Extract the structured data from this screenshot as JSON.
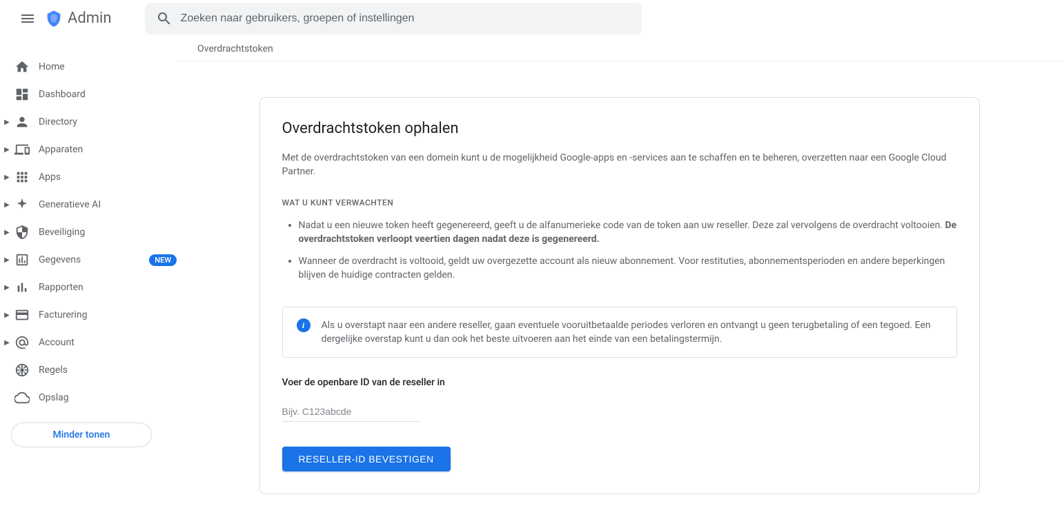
{
  "header": {
    "appName": "Admin",
    "searchPlaceholder": "Zoeken naar gebruikers, groepen of instellingen"
  },
  "sidebar": {
    "items": [
      {
        "label": "Home",
        "expandable": false,
        "icon": "home"
      },
      {
        "label": "Dashboard",
        "expandable": false,
        "icon": "dashboard"
      },
      {
        "label": "Directory",
        "expandable": true,
        "icon": "person"
      },
      {
        "label": "Apparaten",
        "expandable": true,
        "icon": "devices"
      },
      {
        "label": "Apps",
        "expandable": true,
        "icon": "apps"
      },
      {
        "label": "Generatieve AI",
        "expandable": true,
        "icon": "sparkle"
      },
      {
        "label": "Beveiliging",
        "expandable": true,
        "icon": "shield"
      },
      {
        "label": "Gegevens",
        "expandable": true,
        "icon": "data",
        "badge": "NEW"
      },
      {
        "label": "Rapporten",
        "expandable": true,
        "icon": "bars"
      },
      {
        "label": "Facturering",
        "expandable": true,
        "icon": "card"
      },
      {
        "label": "Account",
        "expandable": true,
        "icon": "at"
      },
      {
        "label": "Regels",
        "expandable": false,
        "icon": "wheel"
      },
      {
        "label": "Opslag",
        "expandable": false,
        "icon": "cloud"
      }
    ],
    "lessButton": "Minder tonen"
  },
  "breadcrumb": "Overdrachtstoken",
  "card": {
    "title": "Overdrachtstoken ophalen",
    "description": "Met de overdrachtstoken van een domein kunt u de mogelijkheid Google-apps en -services aan te schaffen en te beheren, overzetten naar een Google Cloud Partner.",
    "expectLabel": "WAT U KUNT VERWACHTEN",
    "bullet1a": "Nadat u een nieuwe token heeft gegenereerd, geeft u de alfanumerieke code van de token aan uw reseller. Deze zal vervolgens de overdracht voltooien. ",
    "bullet1b": "De overdrachtstoken verloopt veertien dagen nadat deze is gegenereerd.",
    "bullet2": "Wanneer de overdracht is voltooid, geldt uw overgezette account als nieuw abonnement. Voor restituties, abonnementsperioden en andere beperkingen blijven de huidige contracten gelden.",
    "infoText": "Als u overstapt naar een andere reseller, gaan eventuele vooruitbetaalde periodes verloren en ontvangt u geen terugbetaling of een tegoed. Een dergelijke overstap kunt u dan ook het beste uitvoeren aan het einde van een betalingstermijn.",
    "fieldLabel": "Voer de openbare ID van de reseller in",
    "fieldPlaceholder": "Bijv. C123abcde",
    "buttonLabel": "RESELLER-ID BEVESTIGEN"
  }
}
